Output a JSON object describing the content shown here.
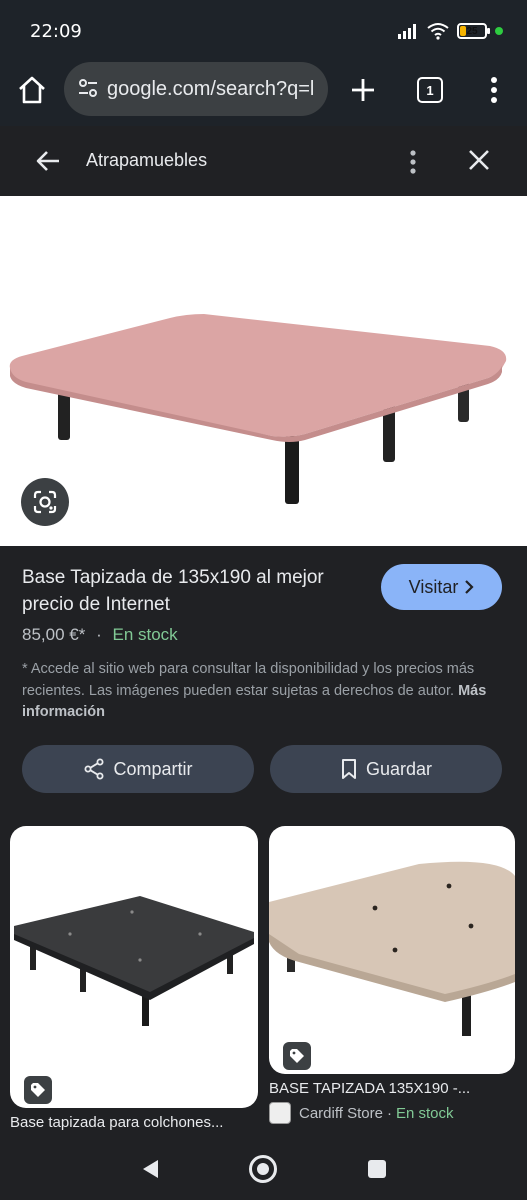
{
  "status": {
    "time": "22:09",
    "battery": "25"
  },
  "browser": {
    "url": "google.com/search?q=l",
    "tab_count": "1"
  },
  "sheet": {
    "title": "Atrapamuebles"
  },
  "product": {
    "title": "Base Tapizada de 135x190 al mejor precio de Internet",
    "visit_label": "Visitar",
    "price": "85,00 €*",
    "separator": "·",
    "stock": "En stock",
    "disclaimer": "* Accede al sitio web para consultar la disponibilidad y los precios más recientes. Las imágenes pueden estar sujetas a derechos de autor.",
    "more_info": "Más información",
    "share_label": "Compartir",
    "save_label": "Guardar"
  },
  "related": [
    {
      "caption": "Base tapizada para colchones..."
    },
    {
      "caption": "BASE TAPIZADA 135X190 -...",
      "source": "Cardiff Store",
      "separator": "·",
      "stock": "En stock"
    }
  ],
  "colors": {
    "accent": "#8ab4f8",
    "stock": "#81c995",
    "background": "#202124"
  }
}
